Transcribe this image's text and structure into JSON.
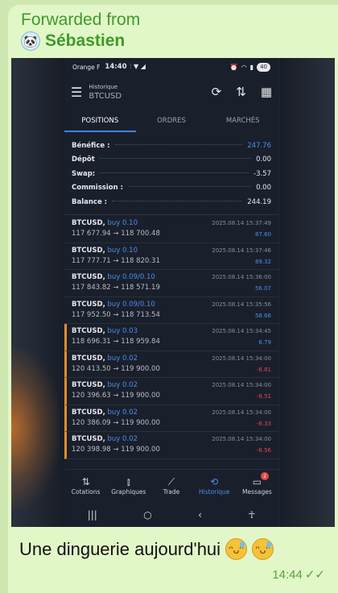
{
  "forward": {
    "label": "Forwarded from",
    "sender": "Sébastien",
    "avatar_icon": "panda-avatar-icon"
  },
  "status_bar": {
    "carrier": "Orange F",
    "time": "14:40",
    "battery": "40"
  },
  "app_bar": {
    "subtitle": "Historique",
    "symbol": "BTCUSD"
  },
  "tabs": [
    "POSITIONS",
    "ORDRES",
    "MARCHÉS"
  ],
  "summary": [
    {
      "label": "Bénéfice :",
      "value": "247.76",
      "accent": "#4a8fe6"
    },
    {
      "label": "Dépôt",
      "value": "0.00"
    },
    {
      "label": "Swap:",
      "value": "-3.57"
    },
    {
      "label": "Commission :",
      "value": "0.00"
    },
    {
      "label": "Balance :",
      "value": "244.19"
    }
  ],
  "deals": [
    {
      "symbol": "BTCUSD,",
      "side": "buy 0.10",
      "prices": "117 677.94 → 118 700.48",
      "date": "2025.08.14 15:37:49",
      "profit": "87.60",
      "sign": "pos",
      "marked": false
    },
    {
      "symbol": "BTCUSD,",
      "side": "buy 0.10",
      "prices": "117 777.71 → 118 820.31",
      "date": "2025.08.14 15:37:46",
      "profit": "89.32",
      "sign": "pos",
      "marked": false
    },
    {
      "symbol": "BTCUSD,",
      "side": "buy 0.09/0.10",
      "prices": "117 843.82 → 118 571.19",
      "date": "2025.08.14 15:36:00",
      "profit": "56.07",
      "sign": "pos",
      "marked": false
    },
    {
      "symbol": "BTCUSD,",
      "side": "buy 0.09/0.10",
      "prices": "117 952.50 → 118 713.54",
      "date": "2025.08.14 15:35:56",
      "profit": "58.66",
      "sign": "pos",
      "marked": false
    },
    {
      "symbol": "BTCUSD,",
      "side": "buy 0.03",
      "prices": "118 696.31 → 118 959.84",
      "date": "2025.08.14 15:34:45",
      "profit": "6.79",
      "sign": "pos",
      "marked": true
    },
    {
      "symbol": "BTCUSD,",
      "side": "buy 0.02",
      "prices": "120 413.50 → 119 900.00",
      "date": "2025.08.14 15:34:00",
      "profit": "-8.81",
      "sign": "neg",
      "marked": true
    },
    {
      "symbol": "BTCUSD,",
      "side": "buy 0.02",
      "prices": "120 396.63 → 119 900.00",
      "date": "2025.08.14 15:34:00",
      "profit": "-8.51",
      "sign": "neg",
      "marked": true
    },
    {
      "symbol": "BTCUSD,",
      "side": "buy 0.02",
      "prices": "120 386.09 → 119 900.00",
      "date": "2025.08.14 15:34:00",
      "profit": "-8.33",
      "sign": "neg",
      "marked": true
    },
    {
      "symbol": "BTCUSD,",
      "side": "buy 0.02",
      "prices": "120 398.98 → 119 900.00",
      "date": "2025.08.14 15:34:00",
      "profit": "-8.56",
      "sign": "neg",
      "marked": true
    }
  ],
  "bottom_nav": [
    {
      "label": "Cotations",
      "icon": "arrows-updown-icon"
    },
    {
      "label": "Graphiques",
      "icon": "candles-icon"
    },
    {
      "label": "Trade",
      "icon": "trend-line-icon"
    },
    {
      "label": "Historique",
      "icon": "history-icon",
      "active": true
    },
    {
      "label": "Messages",
      "icon": "chat-icon",
      "badge": "2"
    }
  ],
  "message": {
    "text": "Une dinguerie aujourd'hui",
    "time": "14:44"
  }
}
